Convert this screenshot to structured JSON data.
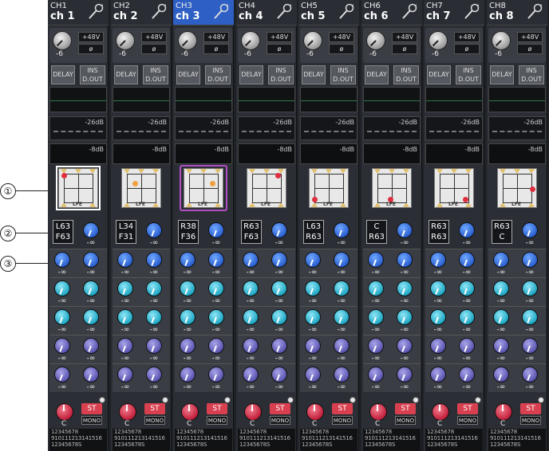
{
  "callouts": [
    "①",
    "②",
    "③"
  ],
  "channels": [
    {
      "num": "CH1",
      "name": "ch 1",
      "gain": "-6",
      "p48": "+48V",
      "phase": "ø",
      "delay": "DELAY",
      "ins": "INS",
      "dout": "D.OUT",
      "comp_db": "-26dB",
      "gate_db": "-8dB",
      "lfe": "LFE",
      "lr_top": "L63",
      "lr_bot": "F63",
      "level": "-∞",
      "sends": [
        "-∞",
        "-∞",
        "-∞",
        "-∞",
        "-∞",
        "-∞",
        "-∞",
        "-∞",
        "-∞",
        "-∞"
      ],
      "pan": "C",
      "st": "ST",
      "mono": "MONO"
    },
    {
      "num": "CH2",
      "name": "ch 2",
      "gain": "-6",
      "p48": "+48V",
      "phase": "ø",
      "delay": "DELAY",
      "ins": "INS",
      "dout": "D.OUT",
      "comp_db": "-26dB",
      "gate_db": "-8dB",
      "lfe": "LFE",
      "lr_top": "L34",
      "lr_bot": "F31",
      "level": "-∞",
      "sends": [
        "-∞",
        "-∞",
        "-∞",
        "-∞",
        "-∞",
        "-∞",
        "-∞",
        "-∞",
        "-∞",
        "-∞"
      ],
      "pan": "C",
      "st": "ST",
      "mono": "MONO"
    },
    {
      "num": "CH3",
      "name": "ch 3",
      "gain": "-6",
      "p48": "+48V",
      "phase": "ø",
      "delay": "DELAY",
      "ins": "INS",
      "dout": "D.OUT",
      "comp_db": "-26dB",
      "gate_db": "-8dB",
      "lfe": "LFE",
      "lr_top": "R38",
      "lr_bot": "F36",
      "level": "-∞",
      "sends": [
        "-∞",
        "-∞",
        "-∞",
        "-∞",
        "-∞",
        "-∞",
        "-∞",
        "-∞",
        "-∞",
        "-∞"
      ],
      "pan": "C",
      "st": "ST",
      "mono": "MONO"
    },
    {
      "num": "CH4",
      "name": "ch 4",
      "gain": "-6",
      "p48": "+48V",
      "phase": "ø",
      "delay": "DELAY",
      "ins": "INS",
      "dout": "D.OUT",
      "comp_db": "-26dB",
      "gate_db": "-8dB",
      "lfe": "LFE",
      "lr_top": "R63",
      "lr_bot": "F63",
      "level": "-∞",
      "sends": [
        "-∞",
        "-∞",
        "-∞",
        "-∞",
        "-∞",
        "-∞",
        "-∞",
        "-∞",
        "-∞",
        "-∞"
      ],
      "pan": "C",
      "st": "ST",
      "mono": "MONO"
    },
    {
      "num": "CH5",
      "name": "ch 5",
      "gain": "-6",
      "p48": "+48V",
      "phase": "ø",
      "delay": "DELAY",
      "ins": "INS",
      "dout": "D.OUT",
      "comp_db": "-26dB",
      "gate_db": "-8dB",
      "lfe": "LFE",
      "lr_top": "L63",
      "lr_bot": "R63",
      "level": "-∞",
      "sends": [
        "-∞",
        "-∞",
        "-∞",
        "-∞",
        "-∞",
        "-∞",
        "-∞",
        "-∞",
        "-∞",
        "-∞"
      ],
      "pan": "C",
      "st": "ST",
      "mono": "MONO"
    },
    {
      "num": "CH6",
      "name": "ch 6",
      "gain": "-6",
      "p48": "+48V",
      "phase": "ø",
      "delay": "DELAY",
      "ins": "INS",
      "dout": "D.OUT",
      "comp_db": "-26dB",
      "gate_db": "-8dB",
      "lfe": "LFE",
      "lr_top": "C",
      "lr_bot": "R63",
      "level": "-∞",
      "sends": [
        "-∞",
        "-∞",
        "-∞",
        "-∞",
        "-∞",
        "-∞",
        "-∞",
        "-∞",
        "-∞",
        "-∞"
      ],
      "pan": "C",
      "st": "ST",
      "mono": "MONO"
    },
    {
      "num": "CH7",
      "name": "ch 7",
      "gain": "-6",
      "p48": "+48V",
      "phase": "ø",
      "delay": "DELAY",
      "ins": "INS",
      "dout": "D.OUT",
      "comp_db": "-26dB",
      "gate_db": "-8dB",
      "lfe": "LFE",
      "lr_top": "R63",
      "lr_bot": "R63",
      "level": "-∞",
      "sends": [
        "-∞",
        "-∞",
        "-∞",
        "-∞",
        "-∞",
        "-∞",
        "-∞",
        "-∞",
        "-∞",
        "-∞"
      ],
      "pan": "C",
      "st": "ST",
      "mono": "MONO"
    },
    {
      "num": "CH8",
      "name": "ch 8",
      "gain": "-6",
      "p48": "+48V",
      "phase": "ø",
      "delay": "DELAY",
      "ins": "INS",
      "dout": "D.OUT",
      "comp_db": "-26dB",
      "gate_db": "-8dB",
      "lfe": "LFE",
      "lr_top": "R63",
      "lr_bot": "C",
      "level": "-∞",
      "sends": [
        "-∞",
        "-∞",
        "-∞",
        "-∞",
        "-∞",
        "-∞",
        "-∞",
        "-∞",
        "-∞",
        "-∞"
      ],
      "pan": "C",
      "st": "ST",
      "mono": "MONO"
    }
  ],
  "assign_rows": [
    "12345678",
    "910111213141516",
    "12345678S"
  ],
  "selected_channel": 2,
  "colors": {
    "selected_header": "#2d5fc4",
    "width_outline": "#b04fc4",
    "pan_dot_red": "#e03040",
    "pan_dot_orange": "#f0a040"
  },
  "icons": {
    "header": "microphone-icon",
    "pan_markers": "speaker-icon"
  }
}
